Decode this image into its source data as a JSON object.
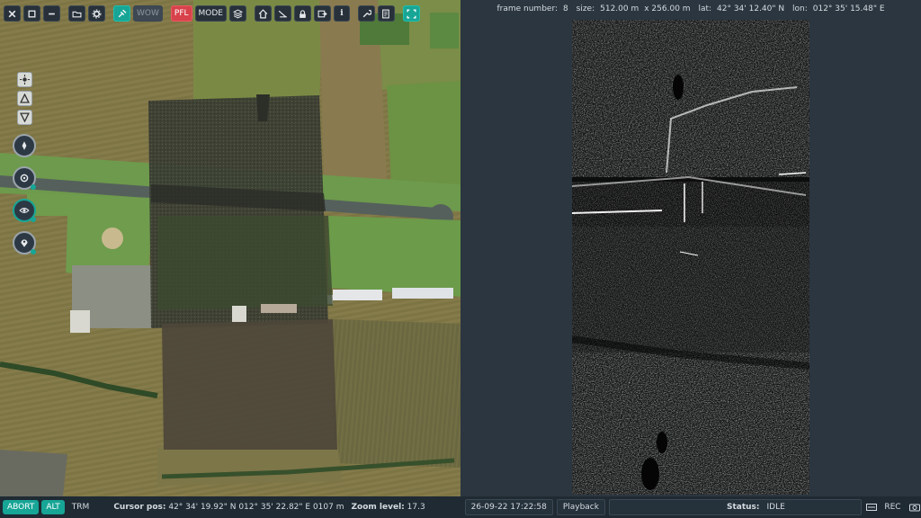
{
  "toolbar": {
    "buttons": [
      {
        "name": "close-icon"
      },
      {
        "name": "maximize-icon"
      },
      {
        "name": "minimize-icon"
      },
      {
        "name": "folder-icon"
      },
      {
        "name": "gear-icon"
      },
      {
        "name": "satellite-icon"
      },
      {
        "name": "wow-button",
        "label": "WOW"
      },
      {
        "name": "pfl-button",
        "label": "PFL"
      },
      {
        "name": "mode-button",
        "label": "MODE"
      },
      {
        "name": "layers-icon"
      },
      {
        "name": "home-icon"
      },
      {
        "name": "measure-icon"
      },
      {
        "name": "lock-icon"
      },
      {
        "name": "export-icon"
      },
      {
        "name": "info-icon",
        "label": "i"
      },
      {
        "name": "wrench-icon"
      },
      {
        "name": "report-icon"
      },
      {
        "name": "fullscreen-icon"
      }
    ]
  },
  "sar": {
    "frame_label": "frame number:",
    "frame_number": "8",
    "size_label": "size:",
    "size_x": "512.00 m",
    "size_y": "x 256.00 m",
    "lat_label": "lat:",
    "lat": "42° 34' 12.40\" N",
    "lon_label": "lon:",
    "lon": "012° 35' 15.48\" E"
  },
  "status": {
    "abort_label": "ABORT",
    "alt_label": "ALT",
    "trm_label": "TRM",
    "cursor_label": "Cursor pos:",
    "cursor_value": "42° 34' 19.92\" N 012° 35' 22.82\" E 0107 m",
    "zoom_label": "Zoom level:",
    "zoom_value": "17.3",
    "datetime": "26-09-22 17:22:58",
    "playback_label": "Playback",
    "status_label": "Status:",
    "status_value": "IDLE",
    "rec_label": "REC"
  },
  "colors": {
    "accent": "#17a596",
    "alert": "#d8424b",
    "panel": "#2b3640"
  }
}
